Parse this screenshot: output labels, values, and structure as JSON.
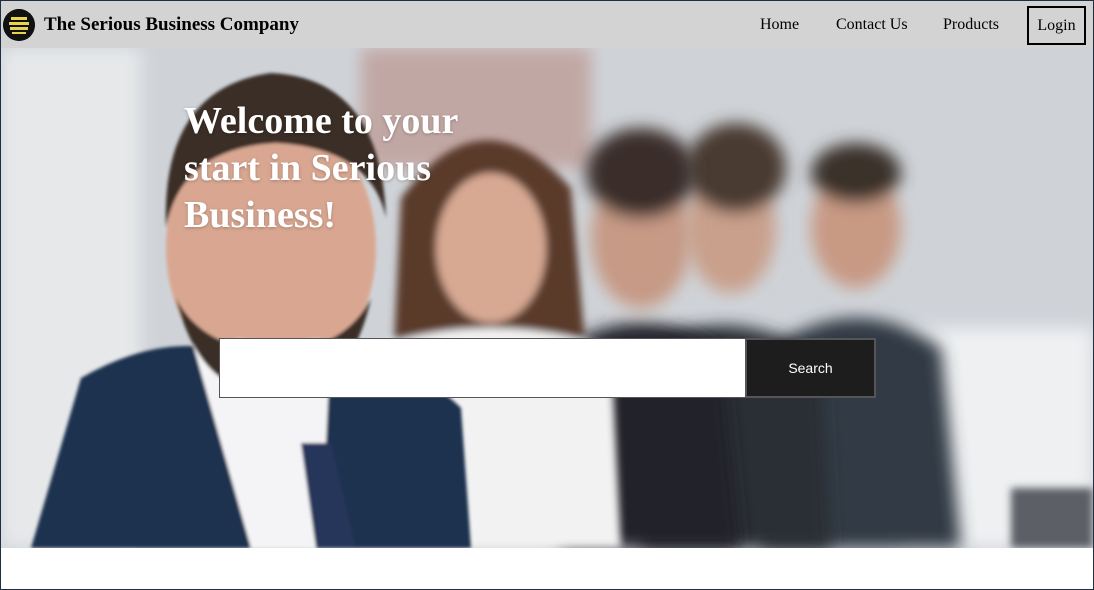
{
  "header": {
    "logo_icon": "company-logo",
    "brand": "The Serious Business Company",
    "nav": {
      "home": "Home",
      "contact": "Contact Us",
      "products": "Products"
    },
    "login": "Login"
  },
  "hero": {
    "title": "Welcome to your start in Serious Business!",
    "search": {
      "value": "",
      "placeholder": "",
      "button": "Search"
    }
  },
  "colors": {
    "header_bg": "#d3d3d3",
    "search_button_bg": "#1d1d1d",
    "hero_title": "#ffffff"
  }
}
